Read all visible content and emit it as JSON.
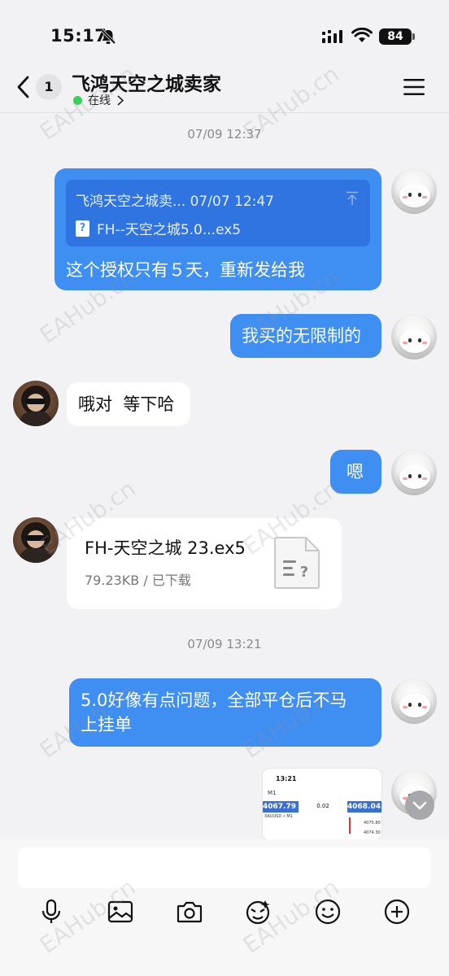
{
  "status_bar": {
    "time": "15:17",
    "battery": "84"
  },
  "header": {
    "unread_count": "1",
    "title": "飞鸿天空之城卖家",
    "status": "在线"
  },
  "messages": {
    "ts1": "07/09 12:37",
    "quote_sender_time": "飞鸿天空之城卖... 07/07 12:47",
    "quote_file_icon": "?",
    "quote_file": "FH--天空之城5.0...ex5",
    "msg1": "这个授权只有５天，重新发给我",
    "msg2": "我买的无限制的",
    "msg3": "哦对  等下哈",
    "msg4": "嗯",
    "file_name": "FH-天空之城 23.ex5",
    "file_info": "79.23KB / 已下载",
    "ts2": "07/09 13:21",
    "msg5_line1": "5.0好像有点问题，全部平仓后不马",
    "msg5_line2": "上挂单"
  },
  "thumbnail": {
    "time": "13:21",
    "label": "M1",
    "sell": "4067.79",
    "qty": "0.02",
    "buy": "4068.04",
    "pair": "XAUUSD • M1",
    "price1": "4075.80",
    "price2": "4074.30"
  },
  "input": {
    "placeholder": ""
  },
  "watermark": "EAHub.cn",
  "colors": {
    "accent": "#3f8ef2",
    "online": "#39d05c"
  },
  "icons": [
    "back-icon",
    "menu-icon",
    "mic-icon",
    "image-icon",
    "camera-icon",
    "sticker-icon",
    "emoji-icon",
    "plus-icon",
    "file-icon",
    "scroll-down-icon"
  ]
}
